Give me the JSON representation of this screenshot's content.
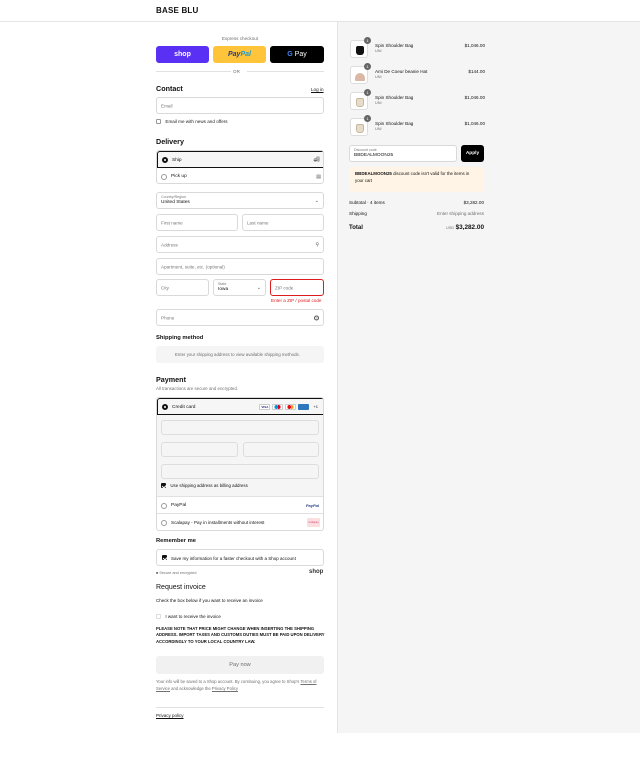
{
  "header": {
    "brand": "BASE BLU"
  },
  "express": {
    "label": "Express checkout",
    "shop": "shop",
    "paypal_a": "Pay",
    "paypal_b": "Pal",
    "gpay": "Pay",
    "gpay_g": "G",
    "or": "OR"
  },
  "contact": {
    "title": "Contact",
    "login": "Log in",
    "email_placeholder": "Email",
    "newsletter": "Email me with news and offers"
  },
  "delivery": {
    "title": "Delivery",
    "options": [
      {
        "label": "Ship",
        "selected": true
      },
      {
        "label": "Pick up",
        "selected": false
      }
    ],
    "country_label": "Country/Region",
    "country_value": "United States",
    "first_name": "First name",
    "last_name": "Last name",
    "address": "Address",
    "apartment": "Apartment, suite, etc. (optional)",
    "city": "City",
    "state_label": "State",
    "state_value": "Iowa",
    "zip": "ZIP code",
    "zip_error": "Enter a ZIP / postal code",
    "phone": "Phone"
  },
  "shipping": {
    "title": "Shipping method",
    "message": "Enter your shipping address to view available shipping methods."
  },
  "payment": {
    "title": "Payment",
    "subtitle": "All transactions are secure and encrypted.",
    "credit_card": "Credit card",
    "card_more": "+1",
    "billing_same": "Use shipping address as billing address",
    "paypal": "PayPal",
    "paypal_logo": "PayPal",
    "scalapay": "Scalapay - Pay in installments without interest",
    "scalapay_logo": "scalapay"
  },
  "remember": {
    "title": "Remember me",
    "save_label": "Save my information for a faster checkout with a Shop account",
    "secure": "Secure and encrypted",
    "shop": "shop"
  },
  "invoice": {
    "title": "Request invoice",
    "subtitle": "Check the box below if you want to receive an invoice",
    "checkbox": "I want to receive the invoice",
    "notice": "PLEASE NOTE THAT PRICE MIGHT CHANGE WHEN INSERTING THE SHIPPING ADDRESS. IMPORT TAXES AND CUSTOMS DUTIES MUST BE PAID UPON DELIVERY ACCORDINGLY TO YOUR LOCAL COUNTRY LAW."
  },
  "pay": {
    "button": "Pay now",
    "consent_a": "Your info will be saved to a Shop account. By continuing, you agree to Shop's",
    "terms": "Terms of Service",
    "consent_b": "and acknowledge the",
    "privacy": "Privacy Policy",
    "footer_link": "Privacy policy"
  },
  "cart": {
    "items": [
      {
        "qty": "1",
        "name": "Spin Shoulder Bag",
        "variant": "UNI",
        "price": "$1,046.00",
        "icon": "black-bag-icon"
      },
      {
        "qty": "1",
        "name": "Ami De Coeur beanie Hat",
        "variant": "UNI",
        "price": "$144.00",
        "icon": "beanie-icon"
      },
      {
        "qty": "1",
        "name": "Spin Shoulder Bag",
        "variant": "UNI",
        "price": "$1,046.00",
        "icon": "cream-bag-icon"
      },
      {
        "qty": "1",
        "name": "Spin Shoulder Bag",
        "variant": "UNI",
        "price": "$1,046.00",
        "icon": "cream-bag-icon"
      }
    ],
    "discount_label": "Discount code",
    "discount_value": "BBDEALMOON25",
    "apply": "Apply",
    "warning_code": "BBDEALMOON25",
    "warning_text": "discount code isn't valid for the items in your cart",
    "subtotal_label": "Subtotal · 4 items",
    "subtotal_value": "$3,282.00",
    "shipping_label": "Shipping",
    "shipping_value": "Enter shipping address",
    "total_label": "Total",
    "currency": "USD",
    "total_value": "$3,282.00"
  },
  "colors": {
    "shop": "#5a31f4",
    "paypal": "#ffc439",
    "error": "#dd1d1d",
    "warning_bg": "#fff4e5"
  }
}
